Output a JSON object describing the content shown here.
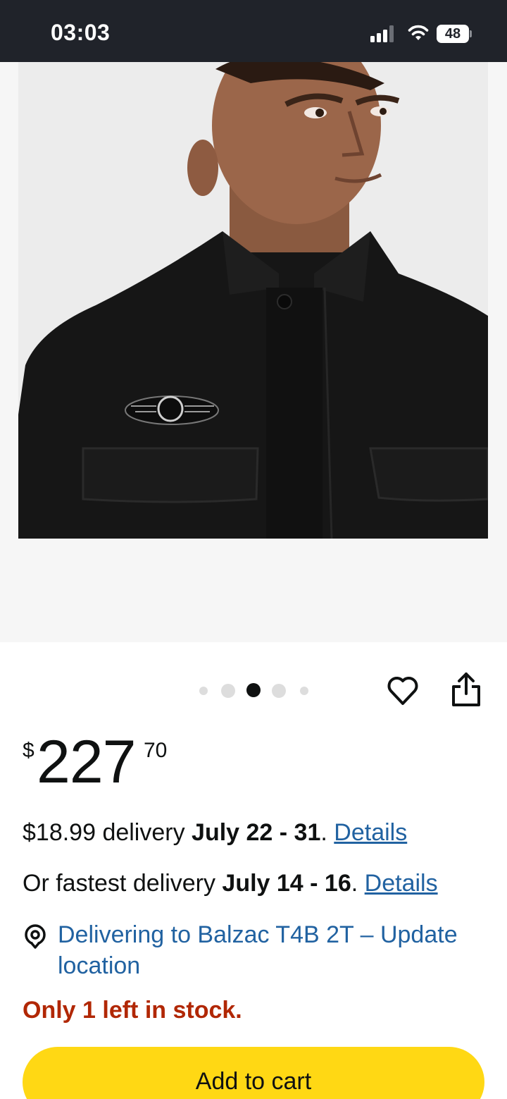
{
  "status_bar": {
    "time": "03:03",
    "battery": "48"
  },
  "carousel": {
    "dot_count": 5,
    "active_index": 2
  },
  "price": {
    "symbol": "$",
    "whole": "227",
    "fraction": "70"
  },
  "delivery": {
    "standard_prefix": "$18.99 delivery ",
    "standard_dates": "July 22 - 31",
    "standard_suffix": ". ",
    "standard_link": "Details",
    "fast_prefix": "Or fastest delivery ",
    "fast_dates": "July 14 - 16",
    "fast_suffix": ". ",
    "fast_link": "Details"
  },
  "location": {
    "text": "Delivering to Balzac T4B 2T – Update location"
  },
  "stock": "Only 1 left in stock.",
  "add_to_cart_label": "Add to cart",
  "icons": {
    "wishlist": "heart-icon",
    "share": "share-icon",
    "location": "location-pin-icon"
  },
  "colors": {
    "link": "#2162a1",
    "stock": "#b12704",
    "cart_button": "#ffd814",
    "status_bar": "#20232a"
  }
}
